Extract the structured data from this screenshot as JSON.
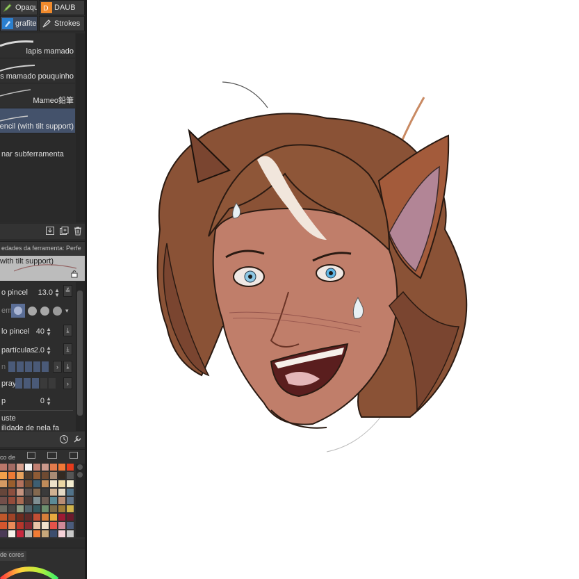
{
  "toolbar": {
    "row1": [
      {
        "label": "Opaque",
        "icon": "pencil-icon"
      },
      {
        "label": "DAUB",
        "icon": "daub-icon"
      }
    ],
    "row2": [
      {
        "label": "grafite",
        "icon": "brush-icon"
      },
      {
        "label": "Strokes",
        "icon": "pen-nib-icon"
      }
    ]
  },
  "brush_list": {
    "items": [
      {
        "label": "lapis mamado",
        "selected": false
      },
      {
        "label": "pis mamado pouquinho",
        "selected": false
      },
      {
        "label": "Mameo鉛筆",
        "selected": false
      },
      {
        "label": "Pencil (with tilt support)",
        "selected": true
      }
    ],
    "add_label": "nar subferramenta"
  },
  "tool_property": {
    "title": "edades da ferramenta: Perfe",
    "preset_name": "with tilt support)",
    "rows": [
      {
        "label": "o pincel",
        "value": "13.0"
      },
      {
        "label": "em",
        "value": ""
      },
      {
        "label": "lo pincel",
        "value": "40"
      },
      {
        "label": "partículas",
        "value": "2.0"
      },
      {
        "label": "n",
        "value": ""
      },
      {
        "label": "pray",
        "value": ""
      },
      {
        "label": "p",
        "value": "0"
      },
      {
        "label": "uste",
        "value": ""
      },
      {
        "label": "ilidade de nela fa",
        "value": ""
      }
    ]
  },
  "color_set": {
    "tab_label": "co de",
    "swatches": [
      "#b9776a",
      "#a36b63",
      "#d7a18f",
      "#f4f4f4",
      "#c17f72",
      "#c9988b",
      "#e27b4c",
      "#f27836",
      "#e63b1c",
      "#f1a04a",
      "#ec7a34",
      "#e7a25d",
      "#503c2c",
      "#8f5b35",
      "#6e4a32",
      "#a98b74",
      "#332a22",
      "#555555",
      "#d49a63",
      "#9a5e2d",
      "#b3725c",
      "#704b30",
      "#3e5f72",
      "#bf8b5a",
      "#ece1c9",
      "#e9d6a3",
      "#f2eccf",
      "#66463a",
      "#8c4f3e",
      "#c4937f",
      "#5a504e",
      "#84694f",
      "#3b3b3b",
      "#cfb191",
      "#e3d9c4",
      "#51738a",
      "#734f4a",
      "#944c3b",
      "#a86a52",
      "#4c3b37",
      "#7f8f92",
      "#6d5e55",
      "#5b8a96",
      "#b98d74",
      "#607489",
      "#6c6c63",
      "#484644",
      "#8e9e86",
      "#52646b",
      "#365a5f",
      "#6d8f6e",
      "#7b6b49",
      "#9e7b36",
      "#d0b34b",
      "#c0582b",
      "#9f4427",
      "#6e2b1e",
      "#5d2a28",
      "#c24f35",
      "#d87f3a",
      "#e8a93f",
      "#9d1a33",
      "#6b1a2c",
      "#d4562e",
      "#e98b59",
      "#b6362b",
      "#872a32",
      "#e9c6a8",
      "#f0e2cc",
      "#e5534a",
      "#d18a98",
      "#4b5c7c",
      "#4a3a56",
      "#f6f2ea",
      "#c8283e",
      "#b8b5ac",
      "#f07c35",
      "#c7a77a",
      "#3d4e6e",
      "#f5d2d8",
      "#c9c9c9"
    ]
  },
  "color_wheel": {
    "tab_label": "de cores"
  },
  "accent": "#44526b"
}
